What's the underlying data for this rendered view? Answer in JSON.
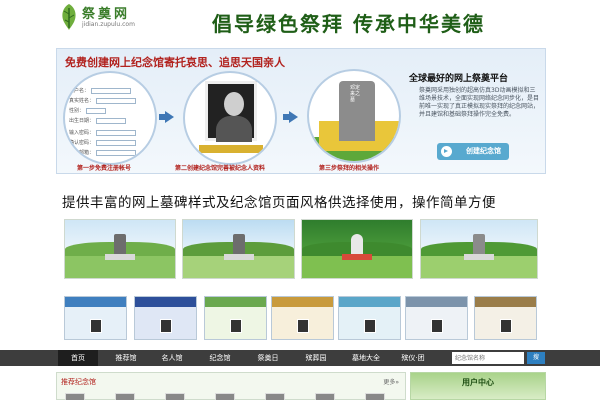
{
  "header": {
    "logo_text": "祭奠网",
    "logo_sub": "jidian.zupulu.com",
    "slogan": "倡导绿色祭拜  传承中华美德"
  },
  "banner": {
    "title": "免费创建网上纪念馆寄托哀思、追思天国亲人",
    "form_labels": [
      "用户名：",
      "真实姓名：",
      "性别：",
      "出生日期：",
      "输入密码：",
      "确认密码：",
      "电子邮箱："
    ],
    "tomb_text": "邓定来之墓",
    "steps": [
      "第一步免费注册帐号",
      "第二创建纪念馆完善被纪念人资料",
      "第三步祭拜的相关操作"
    ],
    "platform_title": "全球最好的网上祭奠平台",
    "platform_desc": "祭奠网采用独创的超高仿真3D动画模拟和三维场景技术，全面实现网络纪念同步化，是目前唯一实现了真正模拟现实祭拜的纪念网站，并且建馆和基础祭拜操作完全免费。",
    "create_button": "创建纪念馆"
  },
  "features": {
    "title": "提供丰富的网上墓碑样式及纪念馆页面风格供选择使用，操作简单方便"
  },
  "nav": {
    "items": [
      "首页",
      "推荐馆",
      "名人馆",
      "纪念馆",
      "祭奠日",
      "殡葬园",
      "墓地大全",
      "殡仪·团"
    ],
    "search_placeholder": "纪念馆名称",
    "search_button": "搜"
  },
  "bottom": {
    "left_title": "推荐纪念馆",
    "more": "更多»",
    "right_title": "用户中心"
  },
  "colors": {
    "accent_red": "#b2231f",
    "brand_green": "#3a7d2a",
    "nav_bg": "#3d3d3d",
    "button_blue": "#58a9cf"
  }
}
